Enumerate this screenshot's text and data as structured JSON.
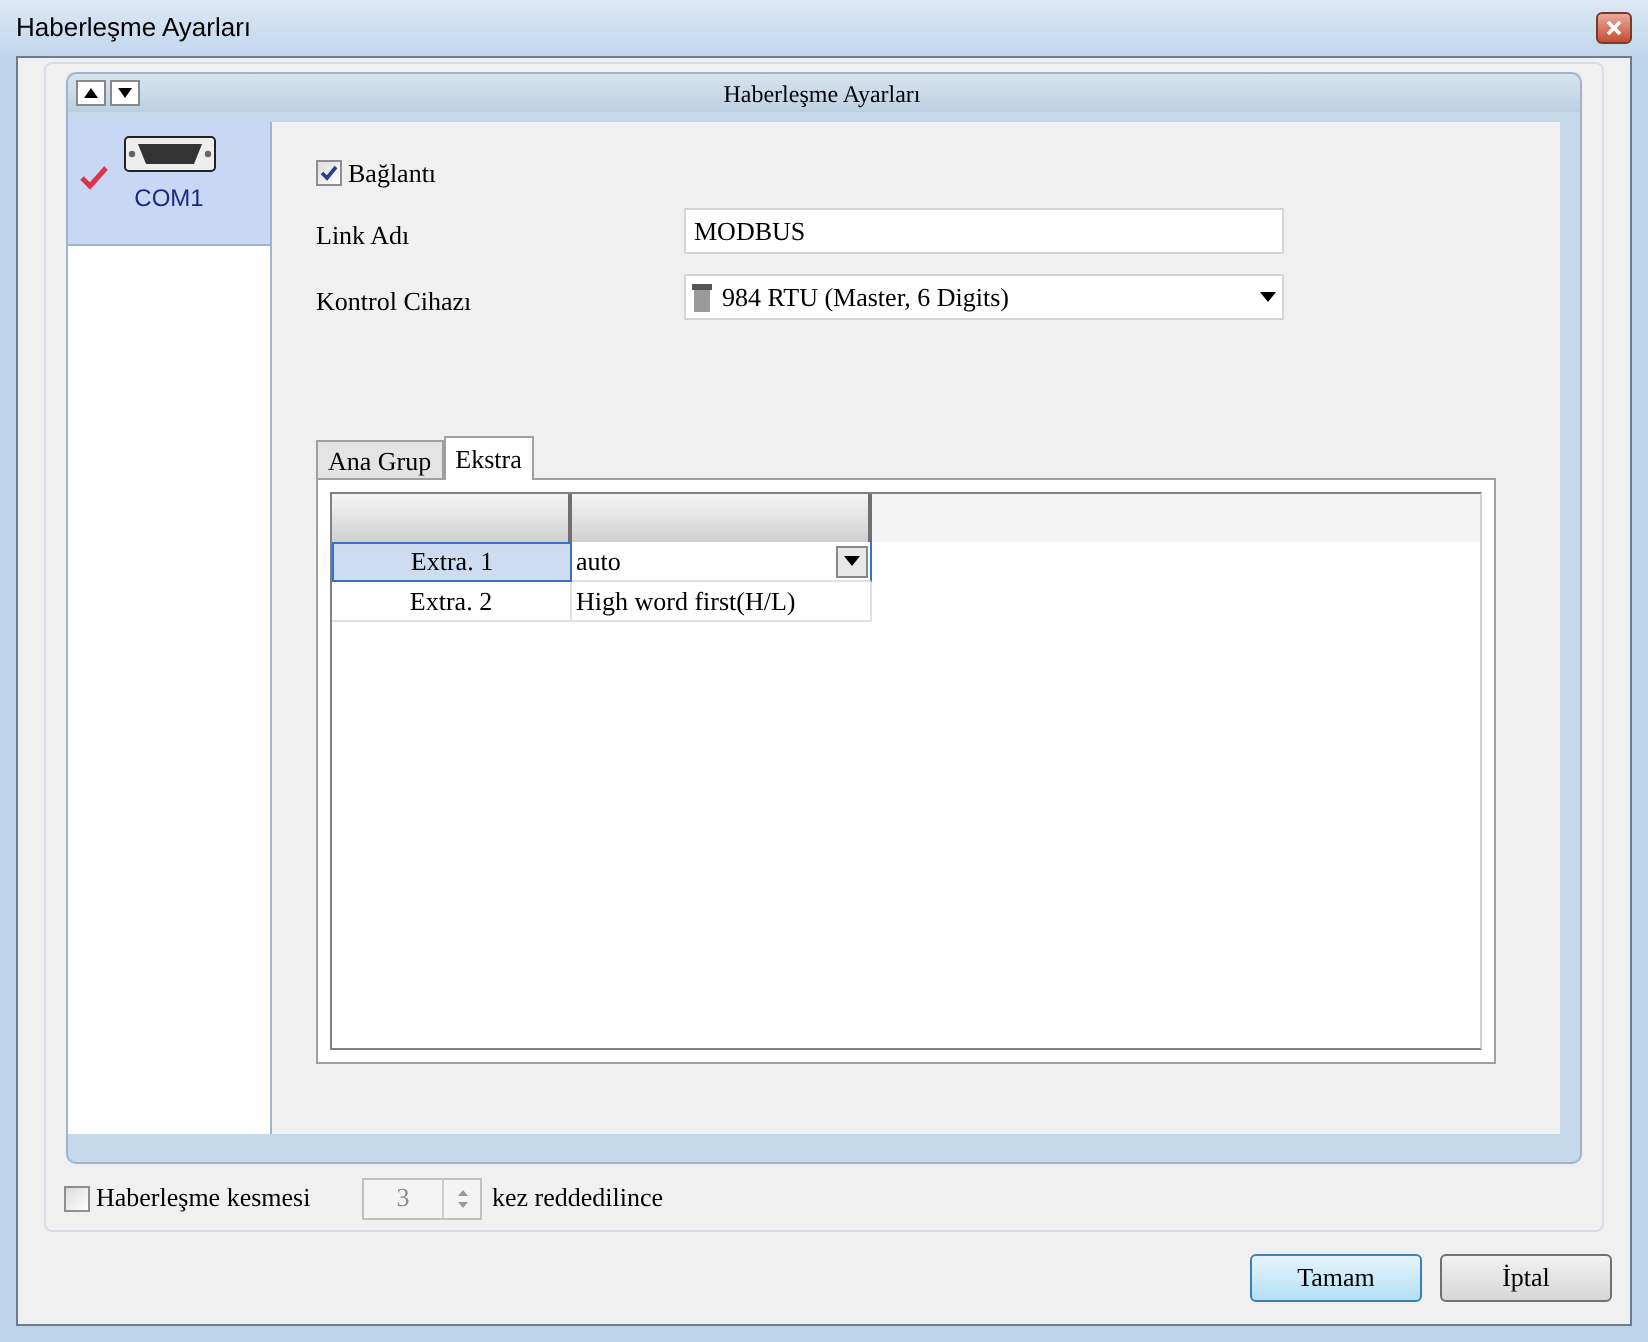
{
  "window": {
    "title": "Haberleşme Ayarları"
  },
  "panel": {
    "title": "Haberleşme Ayarları"
  },
  "ports": [
    {
      "label": "COM1",
      "selected": true,
      "checked": true
    }
  ],
  "connection": {
    "label": "Bağlantı",
    "checked": true
  },
  "fields": [
    {
      "kind": "text",
      "label": "Link Adı",
      "value": "MODBUS"
    },
    {
      "kind": "select",
      "label": "Kontrol Cihazı",
      "value": "984 RTU (Master, 6 Digits)"
    }
  ],
  "tabs": [
    {
      "label": "Ana Grup",
      "selected": false
    },
    {
      "label": "Ekstra",
      "selected": true
    }
  ],
  "table": {
    "rows": [
      {
        "name": "Extra. 1",
        "value": "auto",
        "selected": true
      },
      {
        "name": "Extra. 2",
        "value": "High word first(H/L)",
        "selected": false
      }
    ]
  },
  "retry": {
    "label": "Haberleşme kesmesi",
    "checked": false,
    "value": "3",
    "suffix": "kez reddedilince"
  },
  "buttons": [
    {
      "label": "Tamam",
      "default": true
    },
    {
      "label": "İptal",
      "default": false
    }
  ]
}
